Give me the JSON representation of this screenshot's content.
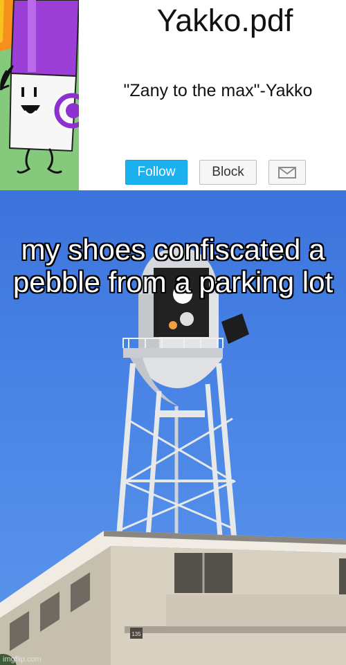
{
  "profile": {
    "username": "Yakko.pdf",
    "bio": "\"Zany to the max\"-Yakko",
    "follow_label": "Follow",
    "block_label": "Block",
    "message_icon": "envelope-icon",
    "avatar_icon": "marker-character-avatar",
    "colors": {
      "avatar_bg": "#84c97c",
      "follow_bg": "#1bb1ef",
      "marker_purple": "#9b3fd6"
    }
  },
  "meme": {
    "caption": "my shoes confiscated a pebble from a parking lot",
    "building_number": "135",
    "watermark": "imgflip.com",
    "colors": {
      "sky": "#4a85e6",
      "caption_text": "#ffffff",
      "caption_outline": "#000000"
    }
  }
}
